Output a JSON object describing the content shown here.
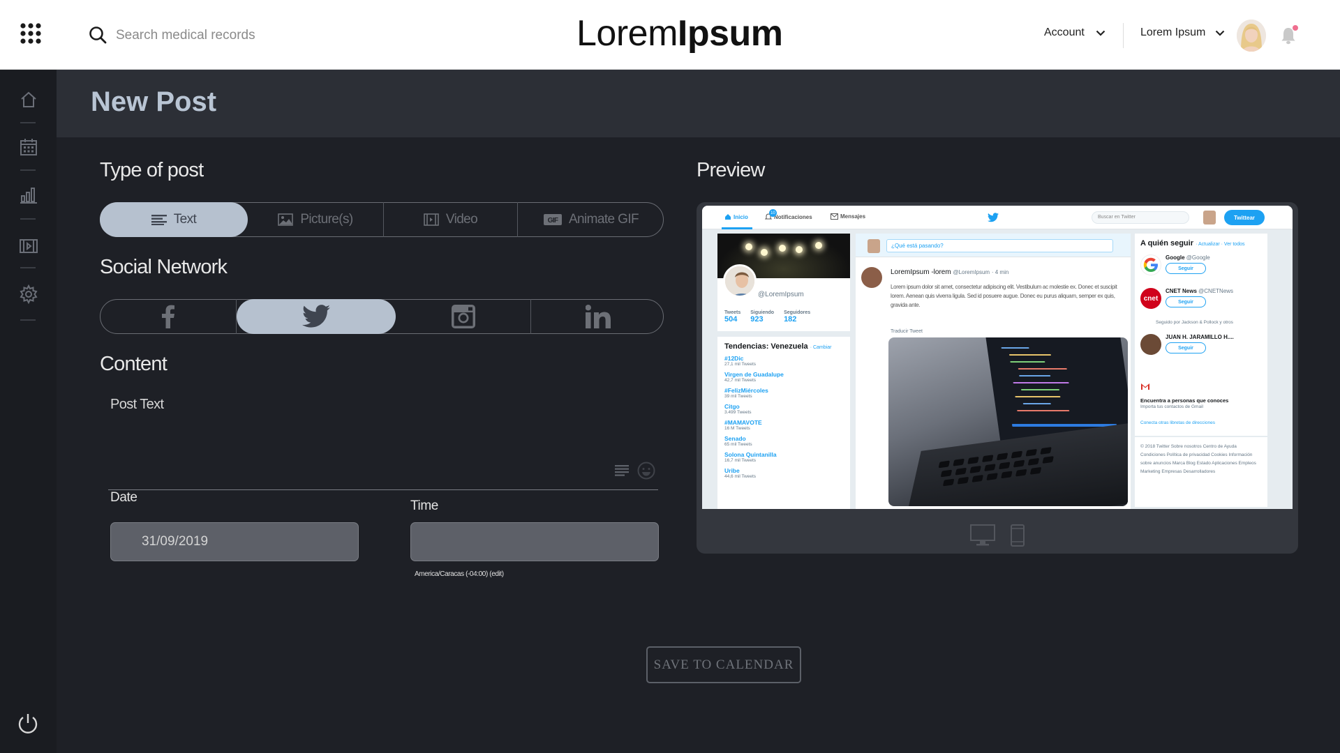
{
  "header": {
    "search_placeholder": "Search medical records",
    "logo_light": "Lorem",
    "logo_bold": "Ipsum",
    "account_label": "Account",
    "user_label": "Lorem Ipsum"
  },
  "sidebar": {
    "items": [
      {
        "icon": "home-icon"
      },
      {
        "icon": "calendar-icon"
      },
      {
        "icon": "bar-chart-icon"
      },
      {
        "icon": "film-icon"
      },
      {
        "icon": "gear-icon"
      }
    ],
    "bottom_icon": "power-icon"
  },
  "page": {
    "title": "New Post"
  },
  "form": {
    "type_heading": "Type of post",
    "post_types": [
      {
        "label": "Text",
        "icon": "text-lines-icon",
        "active": true
      },
      {
        "label": "Picture(s)",
        "icon": "picture-icon",
        "active": false
      },
      {
        "label": "Video",
        "icon": "video-icon",
        "active": false
      },
      {
        "label": "Animate GIF",
        "icon": "gif-icon",
        "active": false
      }
    ],
    "network_heading": "Social Network",
    "networks": [
      {
        "name": "facebook-icon",
        "active": false
      },
      {
        "name": "twitter-icon",
        "active": true
      },
      {
        "name": "instagram-icon",
        "active": false
      },
      {
        "name": "linkedin-icon",
        "active": false
      }
    ],
    "content_heading": "Content",
    "post_text_label": "Post Text",
    "date_label": "Date",
    "date_value": "31/09/2019",
    "time_label": "Time",
    "time_value": "",
    "timezone_note": "America/Caracas (-04:00) (edit)",
    "save_label": "SAVE TO  CALENDAR"
  },
  "preview": {
    "heading": "Preview",
    "devices": [
      "desktop-icon",
      "mobile-icon"
    ],
    "twitter": {
      "nav": {
        "home": "Inicio",
        "notifications": "Notificaciones",
        "notif_count": "10",
        "messages": "Mensajes",
        "search_placeholder": "Buscar en Twitter",
        "tweet_button": "Twittear"
      },
      "profile": {
        "handle": "@LoremIpsum",
        "stats": [
          {
            "label": "Tweets",
            "value": "504"
          },
          {
            "label": "Siguiendo",
            "value": "923"
          },
          {
            "label": "Seguidores",
            "value": "182"
          }
        ]
      },
      "trends": {
        "title": "Tendencias: Venezuela",
        "change": "· Cambiar",
        "items": [
          {
            "name": "#12Dic",
            "count": "27,1 mil Tweets"
          },
          {
            "name": "Virgen de Guadalupe",
            "count": "42,7 mil Tweets"
          },
          {
            "name": "#FelizMiércoles",
            "count": "39 mil Tweets"
          },
          {
            "name": "Citgo",
            "count": "3.499 Tweets"
          },
          {
            "name": "#MAMAVOTE",
            "count": "16 M Tweets"
          },
          {
            "name": "Senado",
            "count": "65 mil Tweets"
          },
          {
            "name": "Solona Quintanilla",
            "count": "16,7 mil Tweets"
          },
          {
            "name": "Uribe",
            "count": "44,6 mil Tweets"
          }
        ]
      },
      "compose_placeholder": "¿Qué está pasando?",
      "post": {
        "name": "LoremIpsum -lorem",
        "handle": "@LoremIpsum",
        "time": "· 4 min",
        "text": "Lorem ipsum dolor sit amet, consectetur adipiscing elit. Vestibulum ac molestie ex. Donec et suscipit lorem. Aenean quis viverra ligula. Sed id posuere augue. Donec eu purus aliquam, semper ex quis, gravida ante.",
        "translate": "Traducir Tweet"
      },
      "who_to_follow": {
        "title": "A quién seguir",
        "links": "· Actualizar · Ver todos",
        "accounts": [
          {
            "name": "Google",
            "handle": "@Google",
            "follow": "Seguir"
          },
          {
            "name": "CNET News",
            "handle": "@CNETNews",
            "follow": "Seguir"
          },
          {
            "name": "JUAN H. JARAMILLO H....",
            "handle": "",
            "follow": "Seguir"
          }
        ],
        "followed_by": "Seguido por Jackson & Pollock y otros",
        "gmail_title": "Encuentra a personas que conoces",
        "gmail_sub": "Importa tus contactos de Gmail",
        "contacts_link": "Conecta otras libretas de direcciones"
      },
      "footer": "© 2018 Twitter  Sobre nosotros  Centro de Ayuda  Condiciones  Política de privacidad  Cookies  Información sobre anuncios  Marca  Blog  Estado  Aplicaciones  Empleos  Marketing  Empresas  Desarrolladores"
    }
  },
  "colors": {
    "accent_active": "#b6c1cf",
    "twitter_blue": "#1da1f2",
    "notification_dot": "#ef6f8f"
  }
}
